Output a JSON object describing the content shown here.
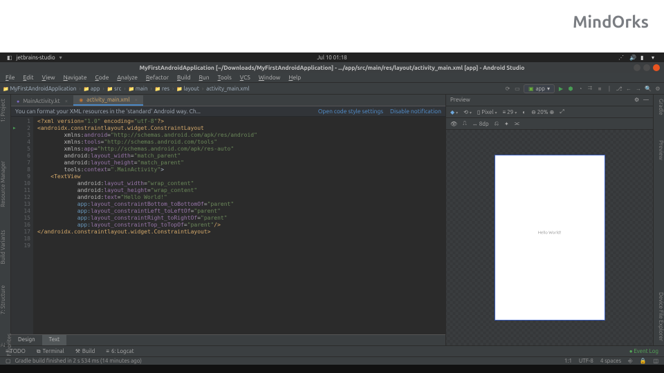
{
  "watermark": "MindOrks",
  "sysbar": {
    "app": "jetbrains-studio",
    "time": "Jul 10  01:18"
  },
  "titlebar": "MyFirstAndroidApplication [~/Downloads/MyFirstAndroidApplication] - .../app/src/main/res/layout/activity_main.xml [app] - Android Studio",
  "menu": [
    "File",
    "Edit",
    "View",
    "Navigate",
    "Code",
    "Analyze",
    "Refactor",
    "Build",
    "Run",
    "Tools",
    "VCS",
    "Window",
    "Help"
  ],
  "crumbs": [
    "MyFirstAndroidApplication",
    "app",
    "src",
    "main",
    "res",
    "layout",
    "activity_main.xml"
  ],
  "run_config": "app",
  "editor_tabs": [
    {
      "label": "MainActivity.kt",
      "type": "kt",
      "active": false
    },
    {
      "label": "activity_main.xml",
      "type": "xml",
      "active": true
    }
  ],
  "banner": {
    "msg": "You can format your XML resources in the 'standard' Android way. Ch...",
    "link1": "Open code style settings",
    "link2": "Disable notification"
  },
  "gutter_lines": 19,
  "code_lines": [
    [
      [
        "<?",
        "t-tag"
      ],
      [
        "xml version=",
        "t-tag"
      ],
      [
        "\"1.0\"",
        "t-val"
      ],
      [
        " encoding=",
        "t-tag"
      ],
      [
        "\"utf-8\"",
        "t-val"
      ],
      [
        "?>",
        "t-tag"
      ]
    ],
    [
      [
        "<",
        "t-tag"
      ],
      [
        "androidx.constraintlayout.widget.ConstraintLayout",
        "t-tag"
      ]
    ],
    [
      [
        "        xmlns:",
        "t-ns"
      ],
      [
        "android",
        "t-attr"
      ],
      [
        "=",
        "t-ns"
      ],
      [
        "\"http://schemas.android.com/apk/res/android\"",
        "t-val"
      ]
    ],
    [
      [
        "        xmlns:",
        "t-ns"
      ],
      [
        "tools",
        "t-attr"
      ],
      [
        "=",
        "t-ns"
      ],
      [
        "\"http://schemas.android.com/tools\"",
        "t-val"
      ]
    ],
    [
      [
        "        xmlns:",
        "t-ns"
      ],
      [
        "app",
        "t-attr"
      ],
      [
        "=",
        "t-ns"
      ],
      [
        "\"http://schemas.android.com/apk/res-auto\"",
        "t-val"
      ]
    ],
    [
      [
        "        android:",
        "t-ns"
      ],
      [
        "layout_width",
        "t-attr"
      ],
      [
        "=",
        "t-ns"
      ],
      [
        "\"match_parent\"",
        "t-val"
      ]
    ],
    [
      [
        "        android:",
        "t-ns"
      ],
      [
        "layout_height",
        "t-attr"
      ],
      [
        "=",
        "t-ns"
      ],
      [
        "\"match_parent\"",
        "t-val"
      ]
    ],
    [
      [
        "        tools:",
        "t-ns"
      ],
      [
        "context",
        "t-attr"
      ],
      [
        "=",
        "t-ns"
      ],
      [
        "\".MainActivity\"",
        "t-val"
      ],
      [
        ">",
        ""
      ]
    ],
    [
      [
        "",
        ""
      ]
    ],
    [
      [
        "    <",
        "t-tag"
      ],
      [
        "TextView",
        "t-tag"
      ]
    ],
    [
      [
        "            android:",
        "t-ns"
      ],
      [
        "layout_width",
        "t-attr"
      ],
      [
        "=",
        "t-ns"
      ],
      [
        "\"wrap_content\"",
        "t-val"
      ]
    ],
    [
      [
        "            android:",
        "t-ns"
      ],
      [
        "layout_height",
        "t-attr"
      ],
      [
        "=",
        "t-ns"
      ],
      [
        "\"wrap_content\"",
        "t-val"
      ]
    ],
    [
      [
        "            android:",
        "t-ns"
      ],
      [
        "text",
        "t-attr"
      ],
      [
        "=",
        "t-ns"
      ],
      [
        "\"Hello World!\"",
        "t-val"
      ]
    ],
    [
      [
        "            app:",
        "t-app"
      ],
      [
        "layout_constraintBottom_toBottomOf",
        "t-attr"
      ],
      [
        "=",
        "t-ns"
      ],
      [
        "\"parent\"",
        "t-val"
      ]
    ],
    [
      [
        "            app:",
        "t-app"
      ],
      [
        "layout_constraintLeft_toLeftOf",
        "t-attr"
      ],
      [
        "=",
        "t-ns"
      ],
      [
        "\"parent\"",
        "t-val"
      ]
    ],
    [
      [
        "            app:",
        "t-app"
      ],
      [
        "layout_constraintRight_toRightOf",
        "t-attr"
      ],
      [
        "=",
        "t-ns"
      ],
      [
        "\"parent\"",
        "t-val"
      ]
    ],
    [
      [
        "            app:",
        "t-app"
      ],
      [
        "layout_constraintTop_toTopOf",
        "t-attr"
      ],
      [
        "=",
        "t-ns"
      ],
      [
        "\"parent\"",
        "t-val"
      ],
      [
        "/>",
        "t-tag"
      ]
    ],
    [
      [
        "",
        ""
      ]
    ],
    [
      [
        "</",
        "t-tag"
      ],
      [
        "androidx.constraintlayout.widget.ConstraintLayout",
        "t-tag"
      ],
      [
        ">",
        "t-tag"
      ]
    ]
  ],
  "design_tabs": {
    "design": "Design",
    "text": "Text"
  },
  "leftstrip": {
    "project": "1: Project",
    "rm": "Resource Manager",
    "bv": "Build Variants",
    "str": "7: Structure",
    "fav": "2: Favorites"
  },
  "rightstrip": {
    "gradle": "Gradle",
    "preview": "Preview",
    "dfe": "Device File Explorer"
  },
  "preview": {
    "title": "Preview",
    "tb1": {
      "pixel": "Pixel",
      "api": "29",
      "zoom": "20%"
    },
    "tb2": {
      "dp": "8dp"
    },
    "devicetext": "Hello World!"
  },
  "btm": {
    "todo": "≡ TODO",
    "term": "Terminal",
    "build": "Build",
    "logcat": "6: Logcat",
    "eventlog": "Event Log"
  },
  "status": {
    "msg": "Gradle build finished in 2 s 534 ms (14 minutes ago)",
    "pos": "1:1",
    "enc": "UTF-8",
    "spaces": "4 spaces"
  }
}
